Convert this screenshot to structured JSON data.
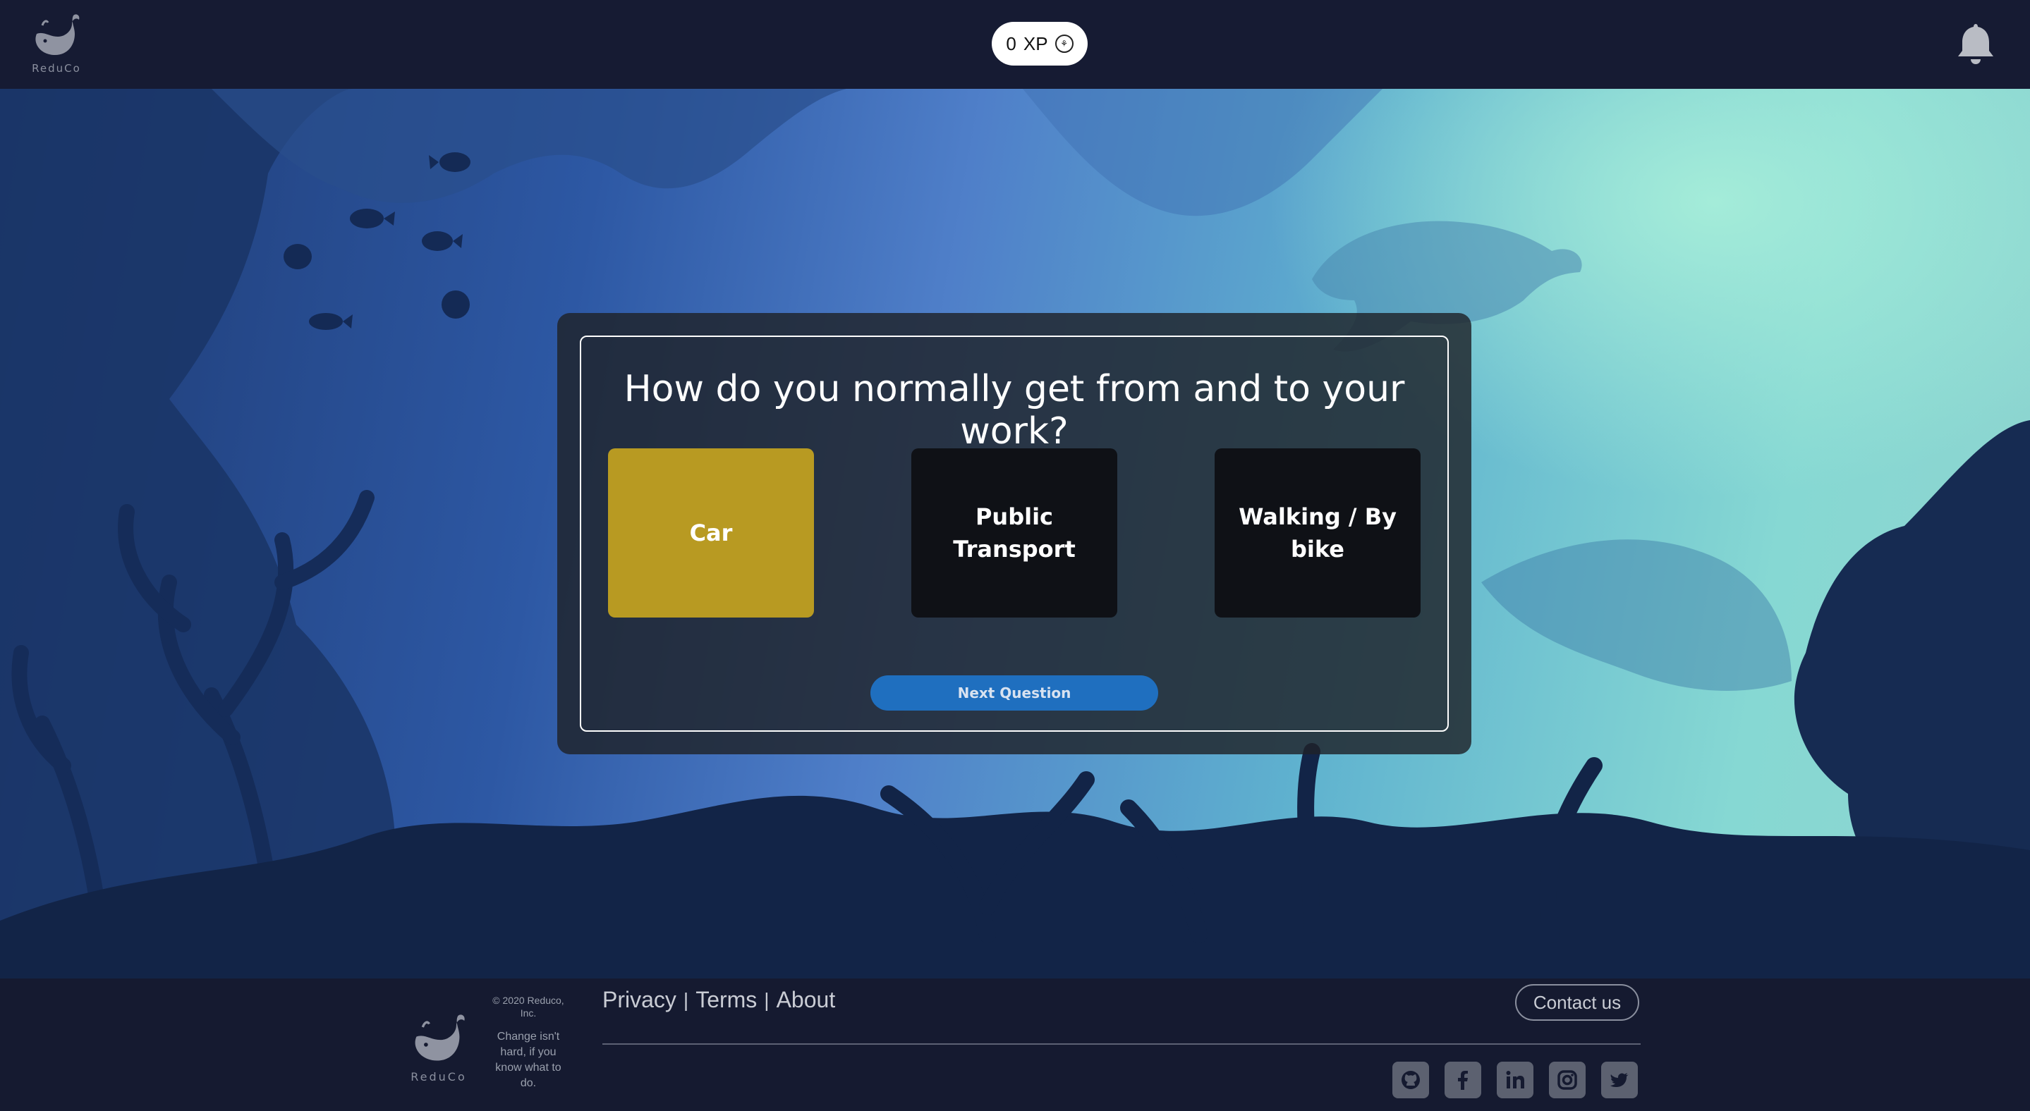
{
  "header": {
    "logo_text": "ReduCo",
    "xp_value": "0",
    "xp_unit": "XP"
  },
  "quiz": {
    "question": "How do you normally get from and to your work?",
    "options": [
      {
        "label": "Car",
        "selected": true
      },
      {
        "label": "Public Transport",
        "selected": false
      },
      {
        "label": "Walking / By bike",
        "selected": false
      }
    ],
    "next_label": "Next Question"
  },
  "footer": {
    "logo_text": "ReduCo",
    "copyright": "© 2020 Reduco, Inc.",
    "tagline": "Change isn't hard, if you know what to do.",
    "links": [
      "Privacy",
      "Terms",
      "About"
    ],
    "contact_label": "Contact us",
    "socials": [
      "github-icon",
      "facebook-icon",
      "linkedin-icon",
      "instagram-icon",
      "twitter-icon"
    ]
  },
  "colors": {
    "selected_option": "#b89a22",
    "next_button": "#1f6fbf",
    "header_bg": "#161b33"
  }
}
